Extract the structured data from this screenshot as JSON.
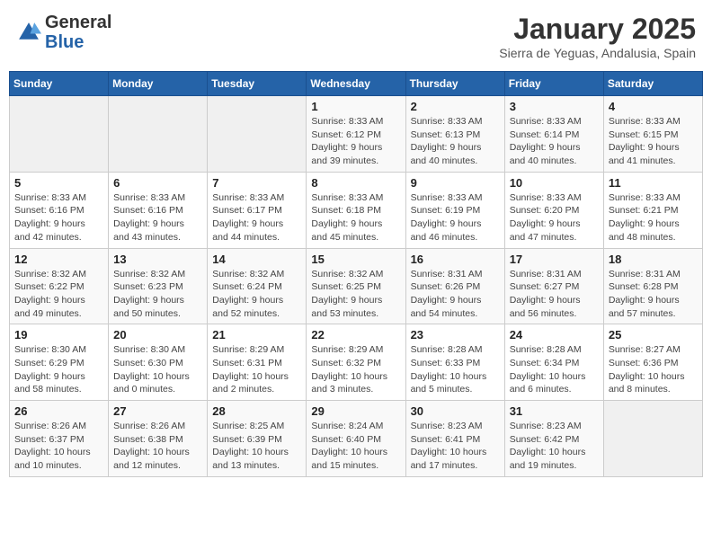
{
  "header": {
    "logo_general": "General",
    "logo_blue": "Blue",
    "month": "January 2025",
    "location": "Sierra de Yeguas, Andalusia, Spain"
  },
  "weekdays": [
    "Sunday",
    "Monday",
    "Tuesday",
    "Wednesday",
    "Thursday",
    "Friday",
    "Saturday"
  ],
  "weeks": [
    [
      {
        "day": "",
        "info": ""
      },
      {
        "day": "",
        "info": ""
      },
      {
        "day": "",
        "info": ""
      },
      {
        "day": "1",
        "info": "Sunrise: 8:33 AM\nSunset: 6:12 PM\nDaylight: 9 hours\nand 39 minutes."
      },
      {
        "day": "2",
        "info": "Sunrise: 8:33 AM\nSunset: 6:13 PM\nDaylight: 9 hours\nand 40 minutes."
      },
      {
        "day": "3",
        "info": "Sunrise: 8:33 AM\nSunset: 6:14 PM\nDaylight: 9 hours\nand 40 minutes."
      },
      {
        "day": "4",
        "info": "Sunrise: 8:33 AM\nSunset: 6:15 PM\nDaylight: 9 hours\nand 41 minutes."
      }
    ],
    [
      {
        "day": "5",
        "info": "Sunrise: 8:33 AM\nSunset: 6:16 PM\nDaylight: 9 hours\nand 42 minutes."
      },
      {
        "day": "6",
        "info": "Sunrise: 8:33 AM\nSunset: 6:16 PM\nDaylight: 9 hours\nand 43 minutes."
      },
      {
        "day": "7",
        "info": "Sunrise: 8:33 AM\nSunset: 6:17 PM\nDaylight: 9 hours\nand 44 minutes."
      },
      {
        "day": "8",
        "info": "Sunrise: 8:33 AM\nSunset: 6:18 PM\nDaylight: 9 hours\nand 45 minutes."
      },
      {
        "day": "9",
        "info": "Sunrise: 8:33 AM\nSunset: 6:19 PM\nDaylight: 9 hours\nand 46 minutes."
      },
      {
        "day": "10",
        "info": "Sunrise: 8:33 AM\nSunset: 6:20 PM\nDaylight: 9 hours\nand 47 minutes."
      },
      {
        "day": "11",
        "info": "Sunrise: 8:33 AM\nSunset: 6:21 PM\nDaylight: 9 hours\nand 48 minutes."
      }
    ],
    [
      {
        "day": "12",
        "info": "Sunrise: 8:32 AM\nSunset: 6:22 PM\nDaylight: 9 hours\nand 49 minutes."
      },
      {
        "day": "13",
        "info": "Sunrise: 8:32 AM\nSunset: 6:23 PM\nDaylight: 9 hours\nand 50 minutes."
      },
      {
        "day": "14",
        "info": "Sunrise: 8:32 AM\nSunset: 6:24 PM\nDaylight: 9 hours\nand 52 minutes."
      },
      {
        "day": "15",
        "info": "Sunrise: 8:32 AM\nSunset: 6:25 PM\nDaylight: 9 hours\nand 53 minutes."
      },
      {
        "day": "16",
        "info": "Sunrise: 8:31 AM\nSunset: 6:26 PM\nDaylight: 9 hours\nand 54 minutes."
      },
      {
        "day": "17",
        "info": "Sunrise: 8:31 AM\nSunset: 6:27 PM\nDaylight: 9 hours\nand 56 minutes."
      },
      {
        "day": "18",
        "info": "Sunrise: 8:31 AM\nSunset: 6:28 PM\nDaylight: 9 hours\nand 57 minutes."
      }
    ],
    [
      {
        "day": "19",
        "info": "Sunrise: 8:30 AM\nSunset: 6:29 PM\nDaylight: 9 hours\nand 58 minutes."
      },
      {
        "day": "20",
        "info": "Sunrise: 8:30 AM\nSunset: 6:30 PM\nDaylight: 10 hours\nand 0 minutes."
      },
      {
        "day": "21",
        "info": "Sunrise: 8:29 AM\nSunset: 6:31 PM\nDaylight: 10 hours\nand 2 minutes."
      },
      {
        "day": "22",
        "info": "Sunrise: 8:29 AM\nSunset: 6:32 PM\nDaylight: 10 hours\nand 3 minutes."
      },
      {
        "day": "23",
        "info": "Sunrise: 8:28 AM\nSunset: 6:33 PM\nDaylight: 10 hours\nand 5 minutes."
      },
      {
        "day": "24",
        "info": "Sunrise: 8:28 AM\nSunset: 6:34 PM\nDaylight: 10 hours\nand 6 minutes."
      },
      {
        "day": "25",
        "info": "Sunrise: 8:27 AM\nSunset: 6:36 PM\nDaylight: 10 hours\nand 8 minutes."
      }
    ],
    [
      {
        "day": "26",
        "info": "Sunrise: 8:26 AM\nSunset: 6:37 PM\nDaylight: 10 hours\nand 10 minutes."
      },
      {
        "day": "27",
        "info": "Sunrise: 8:26 AM\nSunset: 6:38 PM\nDaylight: 10 hours\nand 12 minutes."
      },
      {
        "day": "28",
        "info": "Sunrise: 8:25 AM\nSunset: 6:39 PM\nDaylight: 10 hours\nand 13 minutes."
      },
      {
        "day": "29",
        "info": "Sunrise: 8:24 AM\nSunset: 6:40 PM\nDaylight: 10 hours\nand 15 minutes."
      },
      {
        "day": "30",
        "info": "Sunrise: 8:23 AM\nSunset: 6:41 PM\nDaylight: 10 hours\nand 17 minutes."
      },
      {
        "day": "31",
        "info": "Sunrise: 8:23 AM\nSunset: 6:42 PM\nDaylight: 10 hours\nand 19 minutes."
      },
      {
        "day": "",
        "info": ""
      }
    ]
  ]
}
